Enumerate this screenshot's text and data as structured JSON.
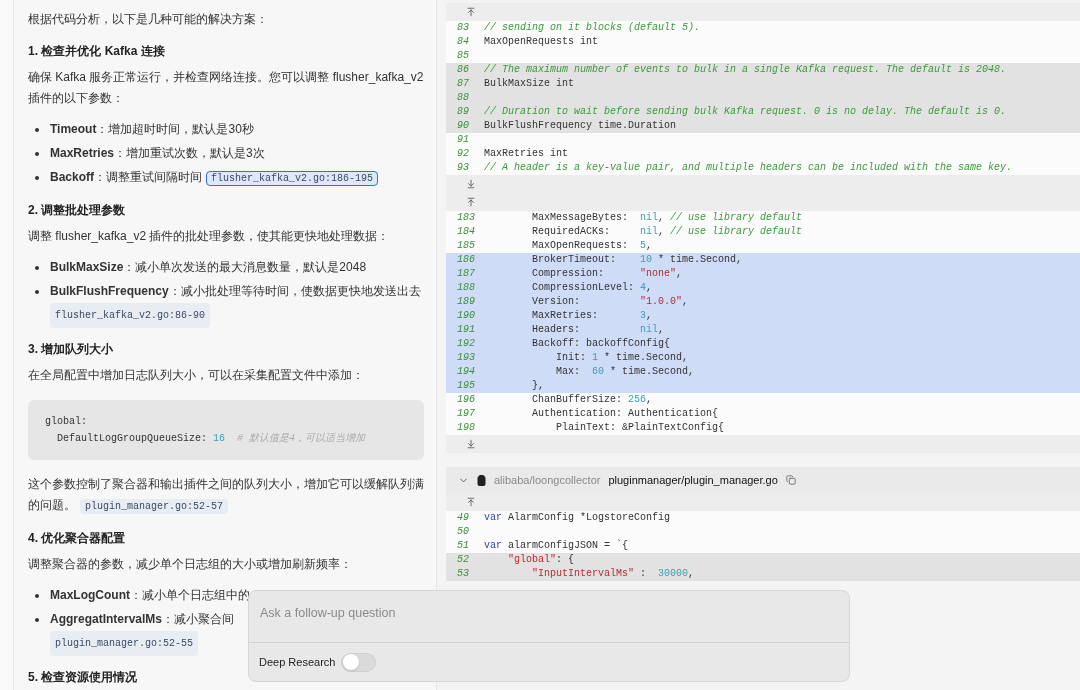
{
  "answer": [
    {
      "kind": "paragraph",
      "text": "根据代码分析，以下是几种可能的解决方案："
    },
    {
      "kind": "heading",
      "text": "1. 检查并优化 Kafka 连接"
    },
    {
      "kind": "paragraph",
      "text": "确保 Kafka 服务正常运行，并检查网络连接。您可以调整 flusher_kafka_v2 插件的以下参数："
    },
    {
      "kind": "bullets",
      "items": [
        {
          "term": "Timeout",
          "text": "：增加超时时间，默认是30秒"
        },
        {
          "term": "MaxRetries",
          "text": "：增加重试次数，默认是3次"
        },
        {
          "term": "Backoff",
          "text": "：调整重试间隔时间",
          "ref": {
            "text": "flusher_kafka_v2.go:186-195",
            "selected": true,
            "own_line": false
          }
        }
      ]
    },
    {
      "kind": "heading",
      "text": "2. 调整批处理参数"
    },
    {
      "kind": "paragraph",
      "text": "调整 flusher_kafka_v2 插件的批处理参数，使其能更快地处理数据："
    },
    {
      "kind": "bullets",
      "items": [
        {
          "term": "BulkMaxSize",
          "text": "：减小单次发送的最大消息数量，默认是2048"
        },
        {
          "term": "BulkFlushFrequency",
          "text": "：减小批处理等待时间，使数据更快地发送出去",
          "ref": {
            "text": "flusher_kafka_v2.go:86-90",
            "selected": false,
            "own_line": true
          }
        }
      ]
    },
    {
      "kind": "heading",
      "text": "3. 增加队列大小"
    },
    {
      "kind": "paragraph",
      "text": "在全局配置中增加日志队列大小，可以在采集配置文件中添加："
    },
    {
      "kind": "code",
      "lines": [
        [
          {
            "kind": "plain",
            "text": "global:"
          }
        ],
        [
          {
            "kind": "plain",
            "text": "  DefaultLogGroupQueueSize: "
          },
          {
            "kind": "number",
            "text": "16"
          },
          {
            "kind": "comment",
            "text": "  # 默认值是4，可以适当增加"
          }
        ]
      ]
    },
    {
      "kind": "paragraph",
      "text": "这个参数控制了聚合器和输出插件之间的队列大小，增加它可以缓解队列满的问题。",
      "ref": {
        "text": "plugin_manager.go:52-57",
        "selected": false,
        "own_line": false
      }
    },
    {
      "kind": "heading",
      "text": "4. 优化聚合器配置"
    },
    {
      "kind": "paragraph",
      "text": "调整聚合器的参数，减少单个日志组的大小或增加刷新频率："
    },
    {
      "kind": "bullets",
      "items": [
        {
          "term": "MaxLogCount",
          "text": "：减小单个日志组中的"
        },
        {
          "term": "AggregatIntervalMs",
          "text": "：减小聚合间",
          "ref": {
            "text": "plugin_manager.go:52-55",
            "selected": false,
            "own_line": true
          }
        }
      ]
    },
    {
      "kind": "heading",
      "text": "5. 检查资源使用情况"
    }
  ],
  "code_blocks": [
    {
      "top_expander": true,
      "bottom_expander": true,
      "lines": [
        {
          "num": "83",
          "highlighted": false,
          "selected": false,
          "tokens": [
            {
              "kind": "comment",
              "text": "// sending on it blocks (default 5)."
            }
          ]
        },
        {
          "num": "84",
          "highlighted": false,
          "selected": false,
          "tokens": [
            {
              "kind": "plain",
              "text": "MaxOpenRequests int"
            }
          ]
        },
        {
          "num": "85",
          "highlighted": false,
          "selected": false
        },
        {
          "num": "86",
          "highlighted": true,
          "selected": false,
          "tokens": [
            {
              "kind": "comment",
              "text": "// The maximum number of events to bulk in a single Kafka request. The default is 2048."
            }
          ]
        },
        {
          "num": "87",
          "highlighted": true,
          "selected": false,
          "tokens": [
            {
              "kind": "plain",
              "text": "BulkMaxSize int"
            }
          ]
        },
        {
          "num": "88",
          "highlighted": true,
          "selected": false
        },
        {
          "num": "89",
          "highlighted": true,
          "selected": false,
          "tokens": [
            {
              "kind": "comment",
              "text": "// Duration to wait before sending bulk Kafka request. 0 is no delay. The default is 0."
            }
          ]
        },
        {
          "num": "90",
          "highlighted": true,
          "selected": false,
          "tokens": [
            {
              "kind": "plain",
              "text": "BulkFlushFrequency time.Duration"
            }
          ]
        },
        {
          "num": "91",
          "highlighted": false,
          "selected": false
        },
        {
          "num": "92",
          "highlighted": false,
          "selected": false,
          "tokens": [
            {
              "kind": "plain",
              "text": "MaxRetries int"
            }
          ]
        },
        {
          "num": "93",
          "highlighted": false,
          "selected": false,
          "tokens": [
            {
              "kind": "comment",
              "text": "// A header is a key-value pair, and multiple headers can be included with the same key."
            }
          ]
        }
      ]
    },
    {
      "top_expander": true,
      "bottom_expander": true,
      "lines": [
        {
          "num": "183",
          "highlighted": false,
          "selected": false,
          "tokens": [
            {
              "kind": "plain",
              "text": "        MaxMessageBytes:  "
            },
            {
              "kind": "number",
              "text": "nil"
            },
            {
              "kind": "plain",
              "text": ", "
            },
            {
              "kind": "comment",
              "text": "// use library default"
            }
          ]
        },
        {
          "num": "184",
          "highlighted": false,
          "selected": false,
          "tokens": [
            {
              "kind": "plain",
              "text": "        RequiredACKs:     "
            },
            {
              "kind": "number",
              "text": "nil"
            },
            {
              "kind": "plain",
              "text": ", "
            },
            {
              "kind": "comment",
              "text": "// use library default"
            }
          ]
        },
        {
          "num": "185",
          "highlighted": false,
          "selected": false,
          "tokens": [
            {
              "kind": "plain",
              "text": "        MaxOpenRequests:  "
            },
            {
              "kind": "number",
              "text": "5"
            },
            {
              "kind": "plain",
              "text": ","
            }
          ]
        },
        {
          "num": "186",
          "highlighted": false,
          "selected": true,
          "tokens": [
            {
              "kind": "plain",
              "text": "        BrokerTimeout:    "
            },
            {
              "kind": "number",
              "text": "10"
            },
            {
              "kind": "plain",
              "text": " * time.Second,"
            }
          ]
        },
        {
          "num": "187",
          "highlighted": false,
          "selected": true,
          "tokens": [
            {
              "kind": "plain",
              "text": "        Compression:      "
            },
            {
              "kind": "string",
              "text": "\"none\""
            },
            {
              "kind": "plain",
              "text": ","
            }
          ]
        },
        {
          "num": "188",
          "highlighted": false,
          "selected": true,
          "tokens": [
            {
              "kind": "plain",
              "text": "        CompressionLevel: "
            },
            {
              "kind": "number",
              "text": "4"
            },
            {
              "kind": "plain",
              "text": ","
            }
          ]
        },
        {
          "num": "189",
          "highlighted": false,
          "selected": true,
          "tokens": [
            {
              "kind": "plain",
              "text": "        Version:          "
            },
            {
              "kind": "string",
              "text": "\"1.0.0\""
            },
            {
              "kind": "plain",
              "text": ","
            }
          ]
        },
        {
          "num": "190",
          "highlighted": false,
          "selected": true,
          "tokens": [
            {
              "kind": "plain",
              "text": "        MaxRetries:       "
            },
            {
              "kind": "number",
              "text": "3"
            },
            {
              "kind": "plain",
              "text": ","
            }
          ]
        },
        {
          "num": "191",
          "highlighted": false,
          "selected": true,
          "tokens": [
            {
              "kind": "plain",
              "text": "        Headers:          "
            },
            {
              "kind": "number",
              "text": "nil"
            },
            {
              "kind": "plain",
              "text": ","
            }
          ]
        },
        {
          "num": "192",
          "highlighted": false,
          "selected": true,
          "tokens": [
            {
              "kind": "plain",
              "text": "        Backoff: backoffConfig{"
            }
          ]
        },
        {
          "num": "193",
          "highlighted": false,
          "selected": true,
          "tokens": [
            {
              "kind": "plain",
              "text": "            Init: "
            },
            {
              "kind": "number",
              "text": "1"
            },
            {
              "kind": "plain",
              "text": " * time.Second,"
            }
          ]
        },
        {
          "num": "194",
          "highlighted": false,
          "selected": true,
          "tokens": [
            {
              "kind": "plain",
              "text": "            Max:  "
            },
            {
              "kind": "number",
              "text": "60"
            },
            {
              "kind": "plain",
              "text": " * time.Second,"
            }
          ]
        },
        {
          "num": "195",
          "highlighted": false,
          "selected": true,
          "tokens": [
            {
              "kind": "plain",
              "text": "        },"
            }
          ]
        },
        {
          "num": "196",
          "highlighted": false,
          "selected": false,
          "tokens": [
            {
              "kind": "plain",
              "text": "        ChanBufferSize: "
            },
            {
              "kind": "number",
              "text": "256"
            },
            {
              "kind": "plain",
              "text": ","
            }
          ]
        },
        {
          "num": "197",
          "highlighted": false,
          "selected": false,
          "tokens": [
            {
              "kind": "plain",
              "text": "        Authentication: Authentication{"
            }
          ]
        },
        {
          "num": "198",
          "highlighted": false,
          "selected": false,
          "tokens": [
            {
              "kind": "plain",
              "text": "            PlainText: &PlainTextConfig{"
            }
          ]
        }
      ]
    },
    {
      "file": {
        "expanded": true,
        "repo": "alibaba/loongcollector",
        "path": "pluginmanager/plugin_manager.go"
      },
      "top_expander": true,
      "lines": [
        {
          "num": "49",
          "highlighted": false,
          "selected": false,
          "tokens": [
            {
              "kind": "keyword",
              "text": "var"
            },
            {
              "kind": "plain",
              "text": " AlarmConfig *LogstoreConfig"
            }
          ]
        },
        {
          "num": "50",
          "highlighted": false,
          "selected": false
        },
        {
          "num": "51",
          "highlighted": false,
          "selected": false,
          "tokens": [
            {
              "kind": "keyword",
              "text": "var"
            },
            {
              "kind": "plain",
              "text": " alarmConfigJSON = `{"
            }
          ]
        },
        {
          "num": "52",
          "highlighted": true,
          "selected": false,
          "tokens": [
            {
              "kind": "string",
              "text": "    \"global\""
            },
            {
              "kind": "plain",
              "text": ": {"
            }
          ]
        },
        {
          "num": "53",
          "highlighted": true,
          "selected": false,
          "tokens": [
            {
              "kind": "string",
              "text": "        \"InputIntervalMs\""
            },
            {
              "kind": "plain",
              "text": " :  "
            },
            {
              "kind": "number",
              "text": "30000"
            },
            {
              "kind": "plain",
              "text": ","
            }
          ]
        }
      ]
    }
  ],
  "follow_up": {
    "placeholder": "Ask a follow-up question",
    "deep_research": {
      "label": "Deep Research",
      "on": false
    }
  }
}
